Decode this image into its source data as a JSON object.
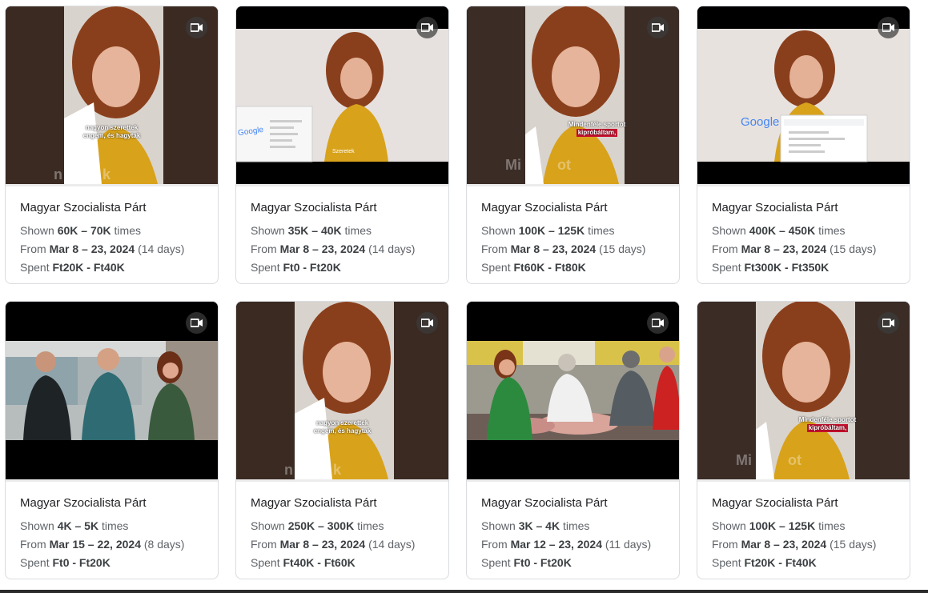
{
  "cards": [
    {
      "advertiser": "Magyar Szocialista Párt",
      "shown_pre": "Shown",
      "shown_val": "60K – 70K",
      "shown_post": "times",
      "from_pre": "From",
      "from_val": "Mar 8 – 23, 2024",
      "from_post": "(14 days)",
      "spent_pre": "Spent",
      "spent_val": "Ft20K - Ft40K",
      "captions": [
        "nagyon szerettek",
        "engem, és hagytak"
      ],
      "watermark": "n          k",
      "media_icon": "video-camera-icon"
    },
    {
      "advertiser": "Magyar Szocialista Párt",
      "shown_pre": "Shown",
      "shown_val": "35K – 40K",
      "shown_post": "times",
      "from_pre": "From",
      "from_val": "Mar 8 – 23, 2024",
      "from_post": "(14 days)",
      "spent_pre": "Spent",
      "spent_val": "Ft0 - Ft20K",
      "google_text": "Google",
      "caption": "Szeretek",
      "media_icon": "video-camera-icon"
    },
    {
      "advertiser": "Magyar Szocialista Párt",
      "shown_pre": "Shown",
      "shown_val": "100K – 125K",
      "shown_post": "times",
      "from_pre": "From",
      "from_val": "Mar 8 – 23, 2024",
      "from_post": "(15 days)",
      "spent_pre": "Spent",
      "spent_val": "Ft60K - Ft80K",
      "captions": [
        "Mindenféle sportot",
        "kipróbáltam,"
      ],
      "watermark": "Mi         ot",
      "media_icon": "video-camera-icon"
    },
    {
      "advertiser": "Magyar Szocialista Párt",
      "shown_pre": "Shown",
      "shown_val": "400K – 450K",
      "shown_post": "times",
      "from_pre": "From",
      "from_val": "Mar 8 – 23, 2024",
      "from_post": "(15 days)",
      "spent_pre": "Spent",
      "spent_val": "Ft300K - Ft350K",
      "google_text": "Google",
      "media_icon": "video-camera-icon"
    },
    {
      "advertiser": "Magyar Szocialista Párt",
      "shown_pre": "Shown",
      "shown_val": "4K – 5K",
      "shown_post": "times",
      "from_pre": "From",
      "from_val": "Mar 15 – 22, 2024",
      "from_post": "(8 days)",
      "spent_pre": "Spent",
      "spent_val": "Ft0 - Ft20K",
      "media_icon": "video-camera-icon"
    },
    {
      "advertiser": "Magyar Szocialista Párt",
      "shown_pre": "Shown",
      "shown_val": "250K – 300K",
      "shown_post": "times",
      "from_pre": "From",
      "from_val": "Mar 8 – 23, 2024",
      "from_post": "(14 days)",
      "spent_pre": "Spent",
      "spent_val": "Ft40K - Ft60K",
      "captions": [
        "nagyon szerettek",
        "engem, és hagytak"
      ],
      "watermark": "n          k",
      "media_icon": "video-camera-icon"
    },
    {
      "advertiser": "Magyar Szocialista Párt",
      "shown_pre": "Shown",
      "shown_val": "3K – 4K",
      "shown_post": "times",
      "from_pre": "From",
      "from_val": "Mar 12 – 23, 2024",
      "from_post": "(11 days)",
      "spent_pre": "Spent",
      "spent_val": "Ft0 - Ft20K",
      "media_icon": "video-camera-icon"
    },
    {
      "advertiser": "Magyar Szocialista Párt",
      "shown_pre": "Shown",
      "shown_val": "100K – 125K",
      "shown_post": "times",
      "from_pre": "From",
      "from_val": "Mar 8 – 23, 2024",
      "from_post": "(15 days)",
      "spent_pre": "Spent",
      "spent_val": "Ft20K - Ft40K",
      "captions": [
        "Mindenféle sportot",
        "kipróbáltam,"
      ],
      "watermark": "Mi         ot",
      "media_icon": "video-camera-icon"
    }
  ]
}
